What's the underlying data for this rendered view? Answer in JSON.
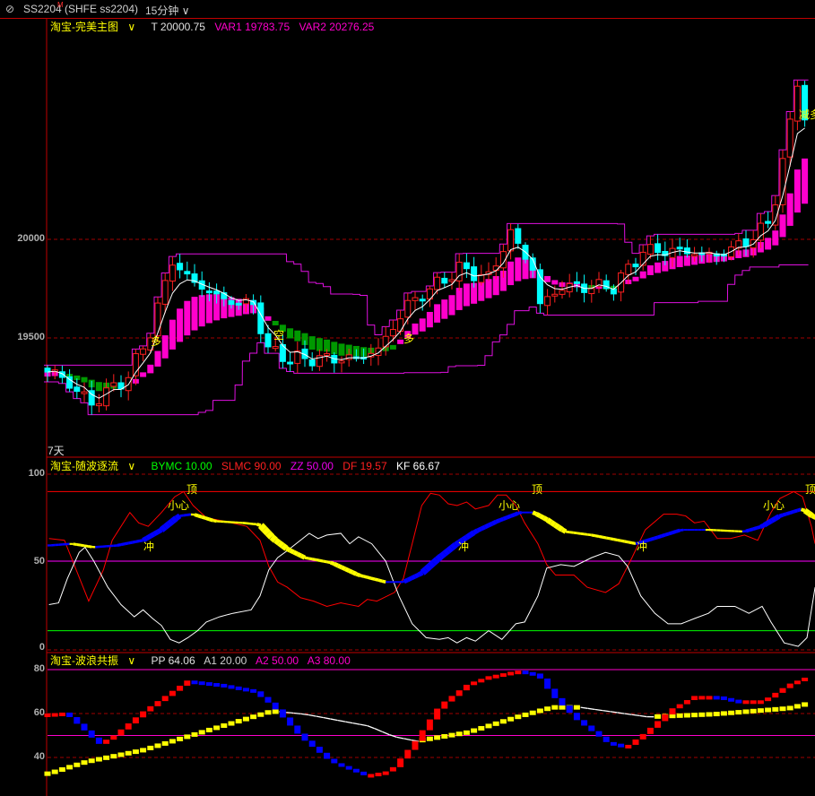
{
  "header": {
    "link_icon": "link-icon",
    "symbol": "SS2204",
    "mark": "M",
    "exchange": "(SHFE ss2204)",
    "period": "15分钟"
  },
  "main": {
    "title": "淘宝-完美主图",
    "t": "T 20000.75",
    "var1": "VAR1 19783.75",
    "var2": "VAR2 20276.25",
    "y_ticks": [
      "20000",
      "19500"
    ],
    "corner": "7天",
    "signals": [
      "多",
      "空",
      "多",
      "减多"
    ]
  },
  "osc": {
    "title": "淘宝-随波逐流",
    "bymc": "BYMC 10.00",
    "slmc": "SLMC 90.00",
    "zz": "ZZ 50.00",
    "df": "DF 19.57",
    "kf": "KF 66.67",
    "y_ticks": [
      "100",
      "50",
      "0"
    ],
    "signals": [
      "顶",
      "小心",
      "冲",
      "顶",
      "小心",
      "冲",
      "顶",
      "小心",
      "冲"
    ]
  },
  "wave": {
    "title": "淘宝-波浪共振",
    "pp": "PP 64.06",
    "a1": "A1 20.00",
    "a2": "A2 50.00",
    "a3": "A3 80.00",
    "y_ticks": [
      "80",
      "60",
      "40"
    ]
  },
  "colors": {
    "up": "#ff2020",
    "down": "#00ffff",
    "bull_band": "#ff00cc",
    "bear_band": "#009900",
    "channel": "#e010e0",
    "accent_yellow": "#ffff00",
    "blue": "#0000ff"
  },
  "chart_data": [
    {
      "type": "candlestick",
      "title": "淘宝-完美主图",
      "bars": 104,
      "ylim": [
        19000,
        21000
      ],
      "reference_lines": [
        20000,
        19500
      ],
      "close_keypoints": [
        [
          1,
          19327
        ],
        [
          6,
          19168
        ],
        [
          11,
          19305
        ],
        [
          14,
          19532
        ],
        [
          17,
          19895
        ],
        [
          19,
          19805
        ],
        [
          24,
          19691
        ],
        [
          28,
          19668
        ],
        [
          30,
          19441
        ],
        [
          33,
          19395
        ],
        [
          42,
          19395
        ],
        [
          45,
          19441
        ],
        [
          49,
          19668
        ],
        [
          56,
          19850
        ],
        [
          60,
          19805
        ],
        [
          63,
          20032
        ],
        [
          66,
          19850
        ],
        [
          67,
          19668
        ],
        [
          70,
          19759
        ],
        [
          77,
          19759
        ],
        [
          81,
          19941
        ],
        [
          86,
          19941
        ],
        [
          91,
          19918
        ],
        [
          95,
          19986
        ],
        [
          98,
          20077
        ],
        [
          99,
          20214
        ],
        [
          101,
          20577
        ],
        [
          102,
          20805
        ],
        [
          103,
          20623
        ]
      ]
    },
    {
      "type": "line",
      "title": "淘宝-随波逐流",
      "ylim": [
        0,
        100
      ],
      "levels": {
        "BYMC": 10,
        "ZZ": 50,
        "SLMC": 90
      },
      "series": [
        {
          "name": "DF",
          "color": "#ff0000",
          "points": [
            [
              0.2,
              63
            ],
            [
              2.3,
              62
            ],
            [
              3.9,
              45
            ],
            [
              5.6,
              27
            ],
            [
              7.6,
              45
            ],
            [
              8.8,
              62
            ],
            [
              11.2,
              78
            ],
            [
              12.4,
              72
            ],
            [
              13.7,
              70
            ],
            [
              15.5,
              78
            ],
            [
              17.3,
              87
            ],
            [
              18.5,
              90
            ],
            [
              19.8,
              82
            ],
            [
              21.6,
              75
            ],
            [
              24,
              73
            ],
            [
              27.1,
              70
            ],
            [
              28.9,
              62
            ],
            [
              30.1,
              47
            ],
            [
              31.3,
              38
            ],
            [
              32.6,
              35
            ],
            [
              34.4,
              29
            ],
            [
              36.2,
              27
            ],
            [
              38,
              24
            ],
            [
              39.9,
              26
            ],
            [
              42.3,
              24
            ],
            [
              43.5,
              28
            ],
            [
              44.8,
              27
            ],
            [
              47.2,
              32
            ],
            [
              48.4,
              40
            ],
            [
              49.6,
              60
            ],
            [
              50.9,
              82
            ],
            [
              52.1,
              89
            ],
            [
              53.3,
              88
            ],
            [
              54.5,
              83
            ],
            [
              55.7,
              82
            ],
            [
              57,
              84
            ],
            [
              58.2,
              80
            ],
            [
              60,
              82
            ],
            [
              61.2,
              88
            ],
            [
              62.4,
              88
            ],
            [
              63.7,
              82
            ],
            [
              64.9,
              72
            ],
            [
              66.7,
              60
            ],
            [
              67.9,
              48
            ],
            [
              69.1,
              42
            ],
            [
              71.6,
              42
            ],
            [
              73.4,
              35
            ],
            [
              75.9,
              32
            ],
            [
              77.7,
              37
            ],
            [
              79.5,
              52
            ],
            [
              81.3,
              68
            ],
            [
              83.8,
              77
            ],
            [
              85.6,
              77
            ],
            [
              86.8,
              76
            ],
            [
              88,
              72
            ],
            [
              89.3,
              73
            ],
            [
              91.1,
              63
            ],
            [
              92.9,
              63
            ],
            [
              94.8,
              65
            ],
            [
              96.6,
              62
            ],
            [
              98.4,
              78
            ],
            [
              99.6,
              86
            ],
            [
              101.5,
              90
            ],
            [
              102.7,
              87
            ],
            [
              103.9,
              70
            ],
            [
              104.4,
              60
            ]
          ]
        },
        {
          "name": "KF",
          "color": "#ffffff",
          "points": [
            [
              0.2,
              25
            ],
            [
              1.5,
              26
            ],
            [
              2.7,
              40
            ],
            [
              4.3,
              55
            ],
            [
              5.1,
              58
            ],
            [
              6.3,
              50
            ],
            [
              8.2,
              35
            ],
            [
              10,
              25
            ],
            [
              11.8,
              18
            ],
            [
              13,
              22
            ],
            [
              14.3,
              17
            ],
            [
              15.5,
              13
            ],
            [
              16.7,
              5
            ],
            [
              17.9,
              3
            ],
            [
              19.1,
              6
            ],
            [
              20.4,
              10
            ],
            [
              21.6,
              15
            ],
            [
              23.4,
              18
            ],
            [
              25.2,
              20
            ],
            [
              27.7,
              22
            ],
            [
              28.9,
              30
            ],
            [
              30.1,
              45
            ],
            [
              31.3,
              52
            ],
            [
              32.6,
              56
            ],
            [
              34.4,
              62
            ],
            [
              35.6,
              66
            ],
            [
              36.8,
              63
            ],
            [
              38,
              65
            ],
            [
              39.9,
              66
            ],
            [
              41.1,
              60
            ],
            [
              42.3,
              64
            ],
            [
              44.1,
              60
            ],
            [
              46,
              50
            ],
            [
              47.8,
              30
            ],
            [
              49.6,
              14
            ],
            [
              51.5,
              6
            ],
            [
              53.3,
              5
            ],
            [
              54.5,
              6
            ],
            [
              55.7,
              3
            ],
            [
              57,
              6
            ],
            [
              58.2,
              4
            ],
            [
              60,
              10
            ],
            [
              61.8,
              5
            ],
            [
              63.7,
              14
            ],
            [
              64.9,
              15
            ],
            [
              66.7,
              30
            ],
            [
              67.9,
              46
            ],
            [
              69.8,
              48
            ],
            [
              71.6,
              47
            ],
            [
              74,
              52
            ],
            [
              75.9,
              55
            ],
            [
              77.7,
              53
            ],
            [
              78.9,
              47
            ],
            [
              80.7,
              30
            ],
            [
              82.6,
              20
            ],
            [
              84.4,
              14
            ],
            [
              86.2,
              14
            ],
            [
              88,
              17
            ],
            [
              89.9,
              20
            ],
            [
              91.1,
              24
            ],
            [
              93.5,
              24
            ],
            [
              95.4,
              20
            ],
            [
              97.2,
              24
            ],
            [
              98.4,
              15
            ],
            [
              100.2,
              3
            ],
            [
              102.1,
              1
            ],
            [
              103.3,
              6
            ],
            [
              104.4,
              35
            ]
          ]
        },
        {
          "name": "trend",
          "color_up": "#0000ff",
          "color_down": "#ffff00",
          "points": [
            [
              0.2,
              59
            ],
            [
              3.3,
              60
            ],
            [
              6.3,
              58
            ],
            [
              9.4,
              59
            ],
            [
              13,
              62
            ],
            [
              15.5,
              68
            ],
            [
              17.9,
              76
            ],
            [
              19.8,
              77
            ],
            [
              22.8,
              73
            ],
            [
              26.5,
              72
            ],
            [
              28.9,
              71
            ],
            [
              30.7,
              63
            ],
            [
              32.6,
              57
            ],
            [
              35,
              52
            ],
            [
              38.7,
              49
            ],
            [
              42.3,
              42
            ],
            [
              46,
              38
            ],
            [
              48.4,
              38
            ],
            [
              50.9,
              43
            ],
            [
              53.3,
              52
            ],
            [
              55.7,
              60
            ],
            [
              58.2,
              67
            ],
            [
              61.2,
              73
            ],
            [
              64.3,
              78
            ],
            [
              66.1,
              78
            ],
            [
              67.9,
              74
            ],
            [
              70.4,
              67
            ],
            [
              74,
              65
            ],
            [
              77.7,
              62
            ],
            [
              80.1,
              60
            ],
            [
              83.2,
              64
            ],
            [
              86.2,
              68
            ],
            [
              89.9,
              68
            ],
            [
              94.8,
              67
            ],
            [
              97.2,
              70
            ],
            [
              99.6,
              76
            ],
            [
              102.7,
              80
            ],
            [
              104.4,
              75
            ]
          ]
        }
      ]
    },
    {
      "type": "step",
      "title": "淘宝-波浪共振",
      "ylim": [
        30,
        82
      ],
      "levels": {
        "A2": 50,
        "A3": 80
      },
      "grid": [
        60,
        40
      ],
      "series": [
        {
          "name": "PP",
          "color_up": "#ff0000",
          "color_down": "#0000ff",
          "points": [
            [
              0.2,
              60
            ],
            [
              2.3,
              60.5
            ],
            [
              5.3,
              51.4
            ],
            [
              6.9,
              46
            ],
            [
              9,
              50
            ],
            [
              13,
              61
            ],
            [
              16,
              68
            ],
            [
              19,
              75
            ],
            [
              23,
              73.5
            ],
            [
              27.8,
              70.6
            ],
            [
              30.5,
              63.7
            ],
            [
              34.5,
              49
            ],
            [
              38.5,
              38
            ],
            [
              43.2,
              32
            ],
            [
              46.6,
              34
            ],
            [
              49.9,
              47
            ],
            [
              53.3,
              63.7
            ],
            [
              57.2,
              73.6
            ],
            [
              60,
              77
            ],
            [
              63.9,
              79.6
            ],
            [
              66.6,
              77.8
            ],
            [
              68.7,
              68
            ],
            [
              72,
              57
            ],
            [
              76,
              47
            ],
            [
              78.7,
              45
            ],
            [
              81.3,
              51.4
            ],
            [
              84.8,
              62
            ],
            [
              88,
              68
            ],
            [
              90.7,
              68
            ],
            [
              93.4,
              66
            ],
            [
              97.4,
              66
            ],
            [
              100.9,
              73.5
            ],
            [
              103.5,
              77
            ],
            [
              104.1,
              73.5
            ]
          ]
        },
        {
          "name": "MA",
          "color_up": "#ffff00",
          "color_down": "#ffffff",
          "points": [
            [
              0.2,
              32.6
            ],
            [
              5.3,
              38
            ],
            [
              13,
              43.3
            ],
            [
              23,
              53.5
            ],
            [
              30.5,
              61
            ],
            [
              34.5,
              59.7
            ],
            [
              43.2,
              54.3
            ],
            [
              46.6,
              49.5
            ],
            [
              49.9,
              47.3
            ],
            [
              57.2,
              51.4
            ],
            [
              63.9,
              58.4
            ],
            [
              68.7,
              62.8
            ],
            [
              72,
              62.8
            ],
            [
              81.3,
              58.4
            ],
            [
              90.7,
              59.7
            ],
            [
              100.9,
              62.4
            ],
            [
              104.1,
              65
            ]
          ]
        }
      ]
    }
  ]
}
